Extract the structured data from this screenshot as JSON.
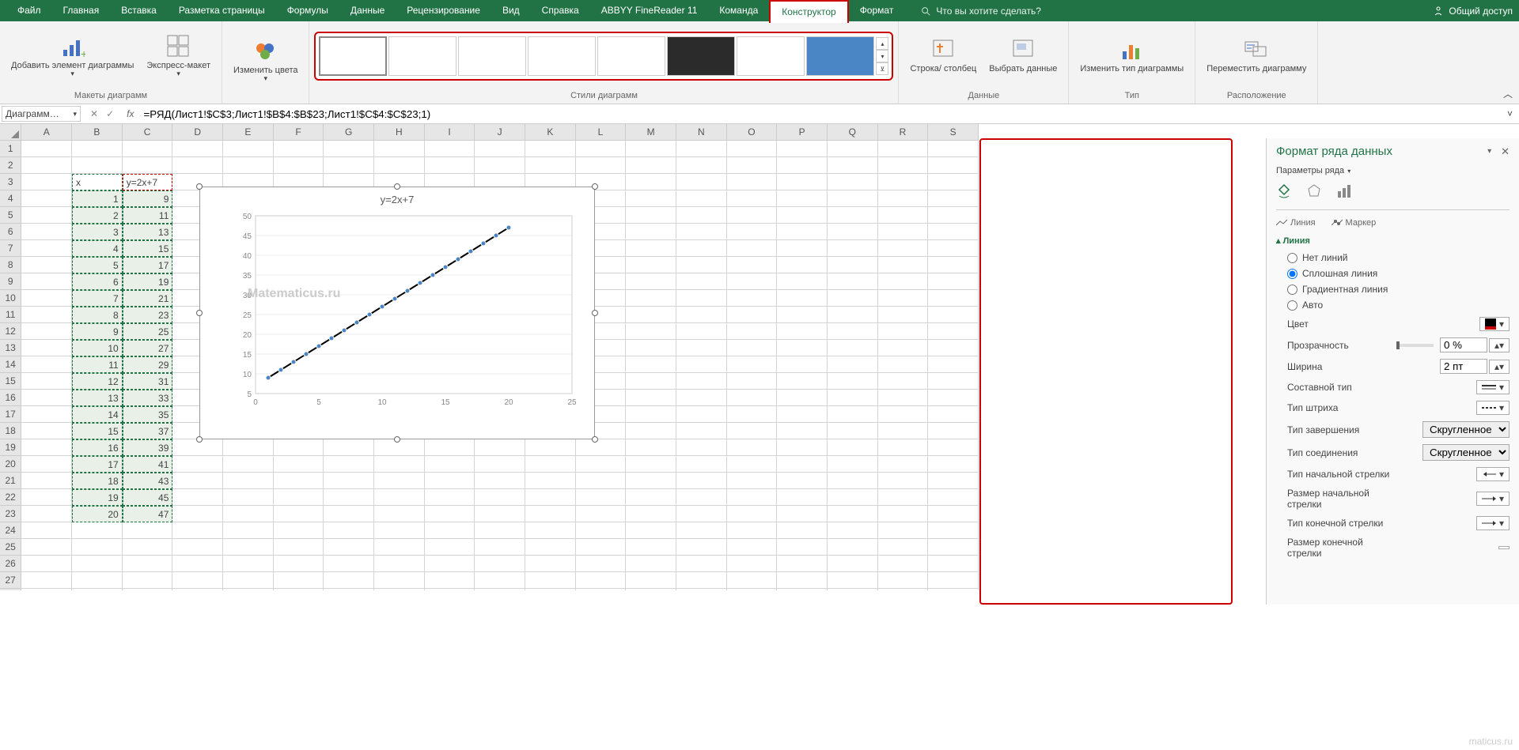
{
  "tabs": [
    "Файл",
    "Главная",
    "Вставка",
    "Разметка страницы",
    "Формулы",
    "Данные",
    "Рецензирование",
    "Вид",
    "Справка",
    "ABBYY FineReader 11",
    "Команда",
    "Конструктор",
    "Формат"
  ],
  "active_tab": "Конструктор",
  "search_placeholder": "Что вы хотите сделать?",
  "share": "Общий доступ",
  "ribbon": {
    "add_el": "Добавить элемент диаграммы",
    "quick_layout": "Экспресс-макет",
    "change_colors": "Изменить цвета",
    "styles_label": "Стили диаграмм",
    "layouts_label": "Макеты диаграмм",
    "swap": "Строка/ столбец",
    "select_data": "Выбрать данные",
    "data_label": "Данные",
    "change_type": "Изменить тип диаграммы",
    "type_label": "Тип",
    "move_chart": "Переместить диаграмму",
    "location_label": "Расположение"
  },
  "name_box": "Диаграмм…",
  "formula": "=РЯД(Лист1!$C$3;Лист1!$B$4:$B$23;Лист1!$C$4:$C$23;1)",
  "cols": [
    "A",
    "B",
    "C",
    "D",
    "E",
    "F",
    "G",
    "H",
    "I",
    "J",
    "K",
    "L",
    "M",
    "N",
    "O",
    "P",
    "Q",
    "R",
    "S"
  ],
  "table": {
    "header": {
      "b": "x",
      "c": "y=2x+7"
    },
    "rows": [
      {
        "r": 4,
        "b": 1,
        "c": 9
      },
      {
        "r": 5,
        "b": 2,
        "c": 11
      },
      {
        "r": 6,
        "b": 3,
        "c": 13
      },
      {
        "r": 7,
        "b": 4,
        "c": 15
      },
      {
        "r": 8,
        "b": 5,
        "c": 17
      },
      {
        "r": 9,
        "b": 6,
        "c": 19
      },
      {
        "r": 10,
        "b": 7,
        "c": 21
      },
      {
        "r": 11,
        "b": 8,
        "c": 23
      },
      {
        "r": 12,
        "b": 9,
        "c": 25
      },
      {
        "r": 13,
        "b": 10,
        "c": 27
      },
      {
        "r": 14,
        "b": 11,
        "c": 29
      },
      {
        "r": 15,
        "b": 12,
        "c": 31
      },
      {
        "r": 16,
        "b": 13,
        "c": 33
      },
      {
        "r": 17,
        "b": 14,
        "c": 35
      },
      {
        "r": 18,
        "b": 15,
        "c": 37
      },
      {
        "r": 19,
        "b": 16,
        "c": 39
      },
      {
        "r": 20,
        "b": 17,
        "c": 41
      },
      {
        "r": 21,
        "b": 18,
        "c": 43
      },
      {
        "r": 22,
        "b": 19,
        "c": 45
      },
      {
        "r": 23,
        "b": 20,
        "c": 47
      }
    ]
  },
  "chart_data": {
    "type": "line",
    "title": "y=2x+7",
    "x": [
      1,
      2,
      3,
      4,
      5,
      6,
      7,
      8,
      9,
      10,
      11,
      12,
      13,
      14,
      15,
      16,
      17,
      18,
      19,
      20
    ],
    "series": [
      {
        "name": "y=2x+7",
        "values": [
          9,
          11,
          13,
          15,
          17,
          19,
          21,
          23,
          25,
          27,
          29,
          31,
          33,
          35,
          37,
          39,
          41,
          43,
          45,
          47
        ]
      }
    ],
    "xticks": [
      0,
      5,
      10,
      15,
      20,
      25
    ],
    "yticks": [
      5,
      10,
      15,
      20,
      25,
      30,
      35,
      40,
      45,
      50
    ],
    "xlim": [
      0,
      25
    ],
    "ylim": [
      5,
      50
    ],
    "watermark": "Matematicus.ru"
  },
  "pane": {
    "title": "Формат ряда данных",
    "subtitle": "Параметры ряда",
    "tab_line": "Линия",
    "tab_marker": "Маркер",
    "section": "Линия",
    "radio": {
      "none": "Нет линий",
      "solid": "Сплошная линия",
      "grad": "Градиентная линия",
      "auto": "Авто",
      "selected": "solid"
    },
    "color_lbl": "Цвет",
    "opacity_lbl": "Прозрачность",
    "opacity_val": "0 %",
    "width_lbl": "Ширина",
    "width_val": "2 пт",
    "compound_lbl": "Составной тип",
    "dash_lbl": "Тип штриха",
    "cap_lbl": "Тип завершения",
    "cap_val": "Скругленное",
    "join_lbl": "Тип соединения",
    "join_val": "Скругленное",
    "arrow_start_type": "Тип начальной стрелки",
    "arrow_start_size": "Размер начальной стрелки",
    "arrow_end_type": "Тип конечной стрелки",
    "arrow_end_size": "Размер конечной стрелки"
  },
  "watermark2": "maticus.ru"
}
